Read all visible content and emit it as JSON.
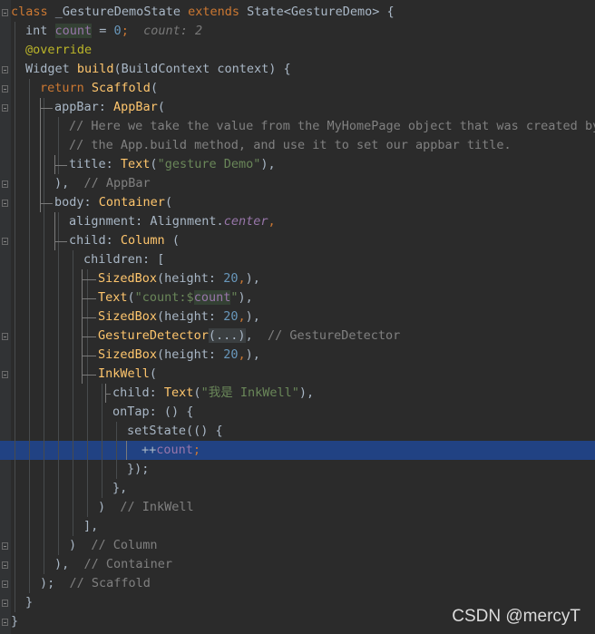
{
  "editor": {
    "lines": [
      {
        "segments": [
          {
            "t": "class ",
            "c": "kw"
          },
          {
            "t": "_GestureDemoState ",
            "c": ""
          },
          {
            "t": "extends ",
            "c": "kw"
          },
          {
            "t": "State<GestureDemo> {",
            "c": ""
          }
        ]
      },
      {
        "segments": [
          {
            "t": "int ",
            "c": ""
          },
          {
            "t": "count",
            "c": "prop hl"
          },
          {
            "t": " = ",
            "c": ""
          },
          {
            "t": "0",
            "c": "num"
          },
          {
            "t": ";",
            "c": "kw"
          },
          {
            "t": "  count: 2",
            "c": "hint"
          }
        ]
      },
      {
        "segments": [
          {
            "t": "@override",
            "c": "ann"
          }
        ]
      },
      {
        "segments": [
          {
            "t": "Widget ",
            "c": ""
          },
          {
            "t": "build",
            "c": "fn"
          },
          {
            "t": "(BuildContext context) {",
            "c": ""
          }
        ]
      },
      {
        "segments": [
          {
            "t": "return ",
            "c": "kw"
          },
          {
            "t": "Scaffold",
            "c": "fn"
          },
          {
            "t": "(",
            "c": ""
          }
        ]
      },
      {
        "segments": [
          {
            "t": "appBar: ",
            "c": ""
          },
          {
            "t": "AppBar",
            "c": "fn"
          },
          {
            "t": "(",
            "c": ""
          }
        ]
      },
      {
        "segments": [
          {
            "t": "// Here we take the value from the MyHomePage object that was created by",
            "c": "cm"
          }
        ]
      },
      {
        "segments": [
          {
            "t": "// the App.build method, and use it to set our appbar title.",
            "c": "cm"
          }
        ]
      },
      {
        "segments": [
          {
            "t": "title: ",
            "c": ""
          },
          {
            "t": "Text",
            "c": "fn"
          },
          {
            "t": "(",
            "c": ""
          },
          {
            "t": "\"gesture Demo\"",
            "c": "str"
          },
          {
            "t": "),",
            "c": ""
          }
        ]
      },
      {
        "segments": [
          {
            "t": "),  ",
            "c": ""
          },
          {
            "t": "// AppBar",
            "c": "cm"
          }
        ]
      },
      {
        "segments": [
          {
            "t": "body: ",
            "c": ""
          },
          {
            "t": "Container",
            "c": "fn"
          },
          {
            "t": "(",
            "c": ""
          }
        ]
      },
      {
        "segments": [
          {
            "t": "alignment: Alignment.",
            "c": ""
          },
          {
            "t": "center",
            "c": "propi"
          },
          {
            "t": ",",
            "c": "kw"
          }
        ]
      },
      {
        "segments": [
          {
            "t": "child: ",
            "c": ""
          },
          {
            "t": "Column",
            "c": "fn"
          },
          {
            "t": " (",
            "c": ""
          }
        ]
      },
      {
        "segments": [
          {
            "t": "children: [",
            "c": ""
          }
        ]
      },
      {
        "segments": [
          {
            "t": "SizedBox",
            "c": "fn"
          },
          {
            "t": "(height: ",
            "c": ""
          },
          {
            "t": "20",
            "c": "num"
          },
          {
            "t": ",",
            "c": "kw"
          },
          {
            "t": "),",
            "c": ""
          }
        ]
      },
      {
        "segments": [
          {
            "t": "Text",
            "c": "fn"
          },
          {
            "t": "(",
            "c": ""
          },
          {
            "t": "\"count:$",
            "c": "str"
          },
          {
            "t": "count",
            "c": "prop hl"
          },
          {
            "t": "\"",
            "c": "str"
          },
          {
            "t": "),",
            "c": ""
          }
        ]
      },
      {
        "segments": [
          {
            "t": "SizedBox",
            "c": "fn"
          },
          {
            "t": "(height: ",
            "c": ""
          },
          {
            "t": "20",
            "c": "num"
          },
          {
            "t": ",",
            "c": "kw"
          },
          {
            "t": "),",
            "c": ""
          }
        ]
      },
      {
        "segments": [
          {
            "t": "GestureDetector",
            "c": "fn"
          },
          {
            "t": "(...)",
            "c": "fold-text"
          },
          {
            "t": ",  ",
            "c": ""
          },
          {
            "t": "// GestureDetector",
            "c": "cm"
          }
        ]
      },
      {
        "segments": [
          {
            "t": "SizedBox",
            "c": "fn"
          },
          {
            "t": "(height: ",
            "c": ""
          },
          {
            "t": "20",
            "c": "num"
          },
          {
            "t": ",",
            "c": "kw"
          },
          {
            "t": "),",
            "c": ""
          }
        ]
      },
      {
        "segments": [
          {
            "t": "InkWell",
            "c": "fn"
          },
          {
            "t": "(",
            "c": ""
          }
        ]
      },
      {
        "segments": [
          {
            "t": "child: ",
            "c": ""
          },
          {
            "t": "Text",
            "c": "fn"
          },
          {
            "t": "(",
            "c": ""
          },
          {
            "t": "\"我是 InkWell\"",
            "c": "str"
          },
          {
            "t": "),",
            "c": ""
          }
        ]
      },
      {
        "segments": [
          {
            "t": "onTap: () {",
            "c": ""
          }
        ]
      },
      {
        "segments": [
          {
            "t": "setState(() {",
            "c": ""
          }
        ]
      },
      {
        "segments": [
          {
            "t": "++",
            "c": ""
          },
          {
            "t": "count",
            "c": "prop"
          },
          {
            "t": ";",
            "c": "kw"
          }
        ]
      },
      {
        "segments": [
          {
            "t": "});",
            "c": ""
          }
        ]
      },
      {
        "segments": [
          {
            "t": "},",
            "c": ""
          }
        ]
      },
      {
        "segments": [
          {
            "t": ")  ",
            "c": ""
          },
          {
            "t": "// InkWell",
            "c": "cm"
          }
        ]
      },
      {
        "segments": [
          {
            "t": "],",
            "c": ""
          }
        ]
      },
      {
        "segments": [
          {
            "t": ")  ",
            "c": ""
          },
          {
            "t": "// Column",
            "c": "cm"
          }
        ]
      },
      {
        "segments": [
          {
            "t": "),  ",
            "c": ""
          },
          {
            "t": "// Container",
            "c": "cm"
          }
        ]
      },
      {
        "segments": [
          {
            "t": ");  ",
            "c": ""
          },
          {
            "t": "// Scaffold",
            "c": "cm"
          }
        ]
      },
      {
        "segments": [
          {
            "t": "}",
            "c": ""
          }
        ]
      },
      {
        "segments": [
          {
            "t": "}",
            "c": ""
          }
        ]
      }
    ]
  },
  "watermark": "CSDN @mercyT",
  "colors": {
    "background": "#2b2b2b",
    "keyword": "#cc7832",
    "function": "#ffc66d",
    "number": "#6897bb",
    "string": "#6a8759",
    "comment": "#808080",
    "annotation": "#bbb529",
    "field": "#9876aa",
    "current_line": "#214283"
  }
}
